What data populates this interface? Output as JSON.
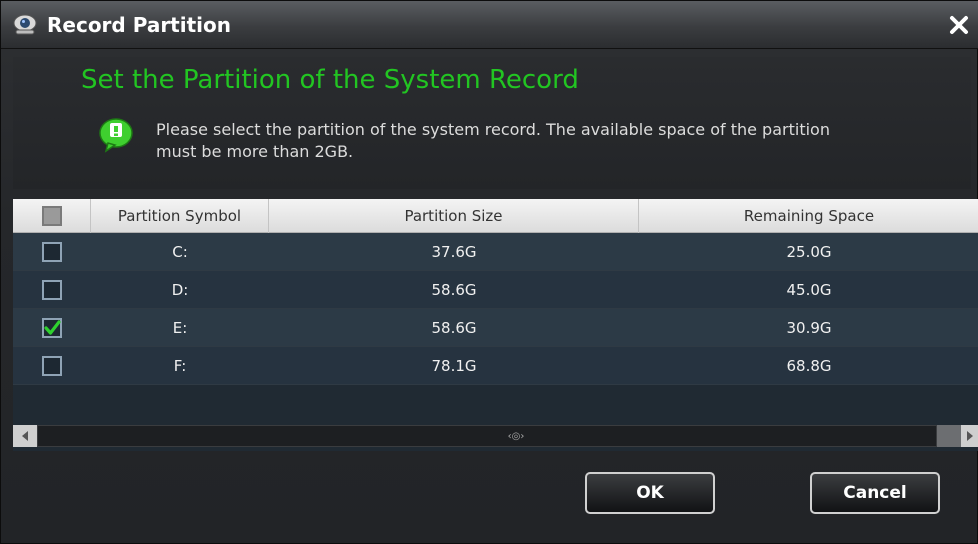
{
  "window": {
    "title": "Record Partition",
    "icon": "camera-icon",
    "close_icon": "close-icon"
  },
  "header": {
    "heading": "Set the Partition of the System Record",
    "info_icon": "speech-bubble-info-icon",
    "info_line1": "Please select the partition of the system record. The available space of the partition",
    "info_line2": "must be more than 2GB."
  },
  "table": {
    "columns": [
      "Partition Symbol",
      "Partition Size",
      "Remaining Space"
    ],
    "rows": [
      {
        "symbol": "C:",
        "size": "37.6G",
        "remaining": "25.0G",
        "checked": false
      },
      {
        "symbol": "D:",
        "size": "58.6G",
        "remaining": "45.0G",
        "checked": false
      },
      {
        "symbol": "E:",
        "size": "58.6G",
        "remaining": "30.9G",
        "checked": true
      },
      {
        "symbol": "F:",
        "size": "78.1G",
        "remaining": "68.8G",
        "checked": false
      }
    ]
  },
  "buttons": {
    "ok": "OK",
    "cancel": "Cancel"
  },
  "colors": {
    "accent_green": "#22c522",
    "checkmark_green": "#2fd12f"
  }
}
